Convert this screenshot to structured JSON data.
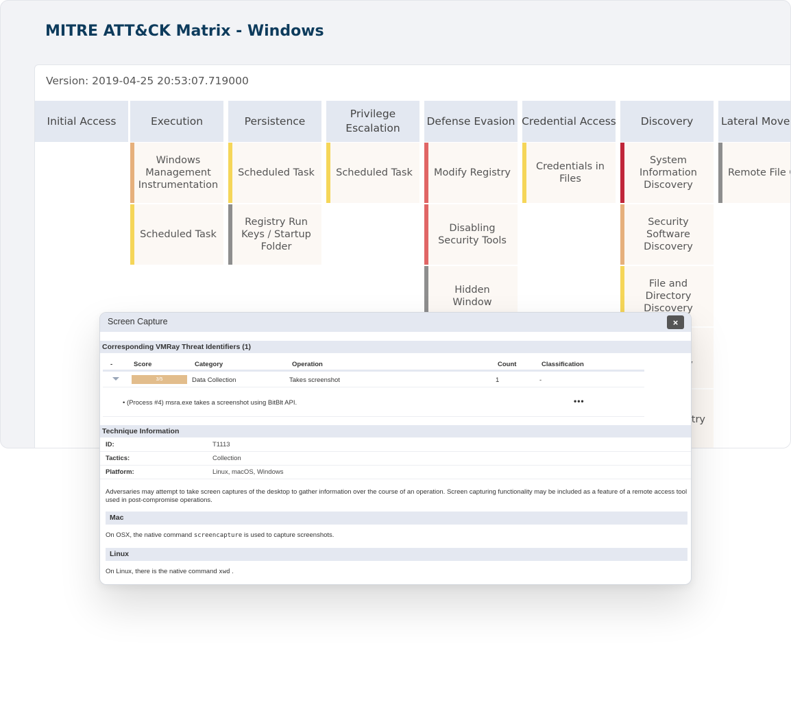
{
  "page": {
    "title": "MITRE ATT&CK Matrix - Windows"
  },
  "matrix": {
    "version": "Version: 2019-04-25 20:53:07.719000",
    "headers": [
      "Initial Access",
      "Execution",
      "Persistence",
      "Privilege Escalation",
      "Defense Evasion",
      "Credential Access",
      "Discovery",
      "Lateral Movement"
    ],
    "colors": {
      "orange": "#e6b07c",
      "yellow": "#f5d659",
      "red": "#e06666",
      "darkred": "#c0263a",
      "gray": "#8e8e8e"
    },
    "cells": {
      "execution": [
        "Windows Management Instrumentation",
        "Scheduled Task"
      ],
      "persistence": [
        "Scheduled Task",
        "Registry Run Keys / Startup Folder"
      ],
      "privilege": [
        "Scheduled Task"
      ],
      "defense": [
        "Modify Registry",
        "Disabling Security Tools",
        "Hidden Window"
      ],
      "credential": [
        "Credentials in Files"
      ],
      "discovery": [
        "System Information Discovery",
        "Security Software Discovery",
        "File and Directory Discovery",
        "Process Discovery",
        "Query Registry"
      ],
      "lateral": [
        "Remote File Copy"
      ]
    }
  },
  "modal": {
    "title": "Screen Capture",
    "close_label": "×",
    "threat_section": "Corresponding VMRay Threat Identifiers (1)",
    "table": {
      "headers": [
        "-",
        "Score",
        "Category",
        "Operation",
        "Count",
        "Classification"
      ],
      "row": {
        "score": "3/5",
        "category": "Data Collection",
        "operation": "Takes screenshot",
        "count": "1",
        "classification": "-"
      },
      "detail": "(Process #4) msra.exe takes a screenshot using BitBlt API.",
      "more": "•••"
    },
    "technique_section": "Technique Information",
    "info": [
      {
        "key": "ID:",
        "value": "T1113"
      },
      {
        "key": "Tactics:",
        "value": "Collection"
      },
      {
        "key": "Platform:",
        "value": "Linux, macOS, Windows"
      }
    ],
    "description": "Adversaries may attempt to take screen captures of the desktop to gather information over the course of an operation. Screen capturing functionality may be included as a feature of a remote access tool used in post-compromise operations.",
    "mac": {
      "heading": "Mac",
      "text_before": "On OSX, the native command ",
      "code": "screencapture",
      "text_after": " is used to capture screenshots."
    },
    "linux": {
      "heading": "Linux",
      "text_before": "On Linux, there is the native command ",
      "code": "xwd",
      "text_after": " ."
    }
  }
}
